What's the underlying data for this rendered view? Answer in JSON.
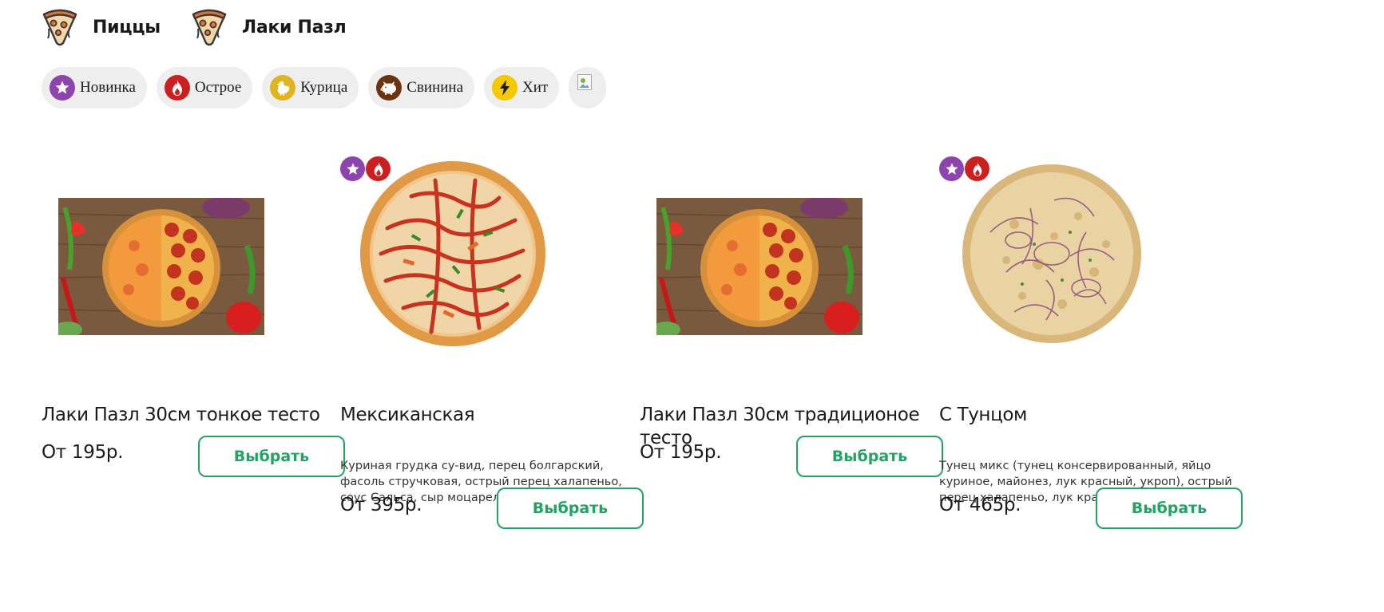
{
  "categories": [
    {
      "label": "Пиццы",
      "icon": "pizza-slice-icon"
    },
    {
      "label": "Лаки Пазл",
      "icon": "pizza-slice-icon"
    }
  ],
  "filters": [
    {
      "label": "Новинка",
      "icon": "star-icon",
      "color": "#8e44ad"
    },
    {
      "label": "Острое",
      "icon": "flame-icon",
      "color": "#cc1f1f"
    },
    {
      "label": "Курица",
      "icon": "chicken-icon",
      "color": "#e0b320"
    },
    {
      "label": "Свинина",
      "icon": "pig-icon",
      "color": "#6b3410"
    },
    {
      "label": "Хит",
      "icon": "lightning-icon",
      "color": "#f5c800"
    },
    {
      "label": "",
      "icon": "broken-image-icon",
      "color": "#eeeeee"
    }
  ],
  "products": [
    {
      "title": "Лаки Пазл 30см тонкое тесто",
      "description": "",
      "price": "От 195р.",
      "button": "Выбрать",
      "badges": []
    },
    {
      "title": "Мексиканская",
      "description": "Куриная грудка су-вид, перец болгарский, фасоль стручковая, острый перец халапеньо, соус Сальса, сыр моцарелла.",
      "price": "От 395р.",
      "button": "Выбрать",
      "badges": [
        "star-icon",
        "flame-icon"
      ]
    },
    {
      "title": "Лаки Пазл 30см традиционое тесто",
      "description": "",
      "price": "От 195р.",
      "button": "Выбрать",
      "badges": []
    },
    {
      "title": "С Тунцом",
      "description": "Тунец микс (тунец консервированный, яйцо куриное, майонез, лук красный, укроп), острый перец халапеньо, лук красный, соус ранч, сыр",
      "price": "От 465р.",
      "button": "Выбрать",
      "badges": [
        "star-icon",
        "flame-icon"
      ]
    }
  ],
  "colors": {
    "accent": "#21a463",
    "chip_bg": "#eeeeee",
    "badge_new": "#8e44ad",
    "badge_spicy": "#cc1f1f"
  }
}
